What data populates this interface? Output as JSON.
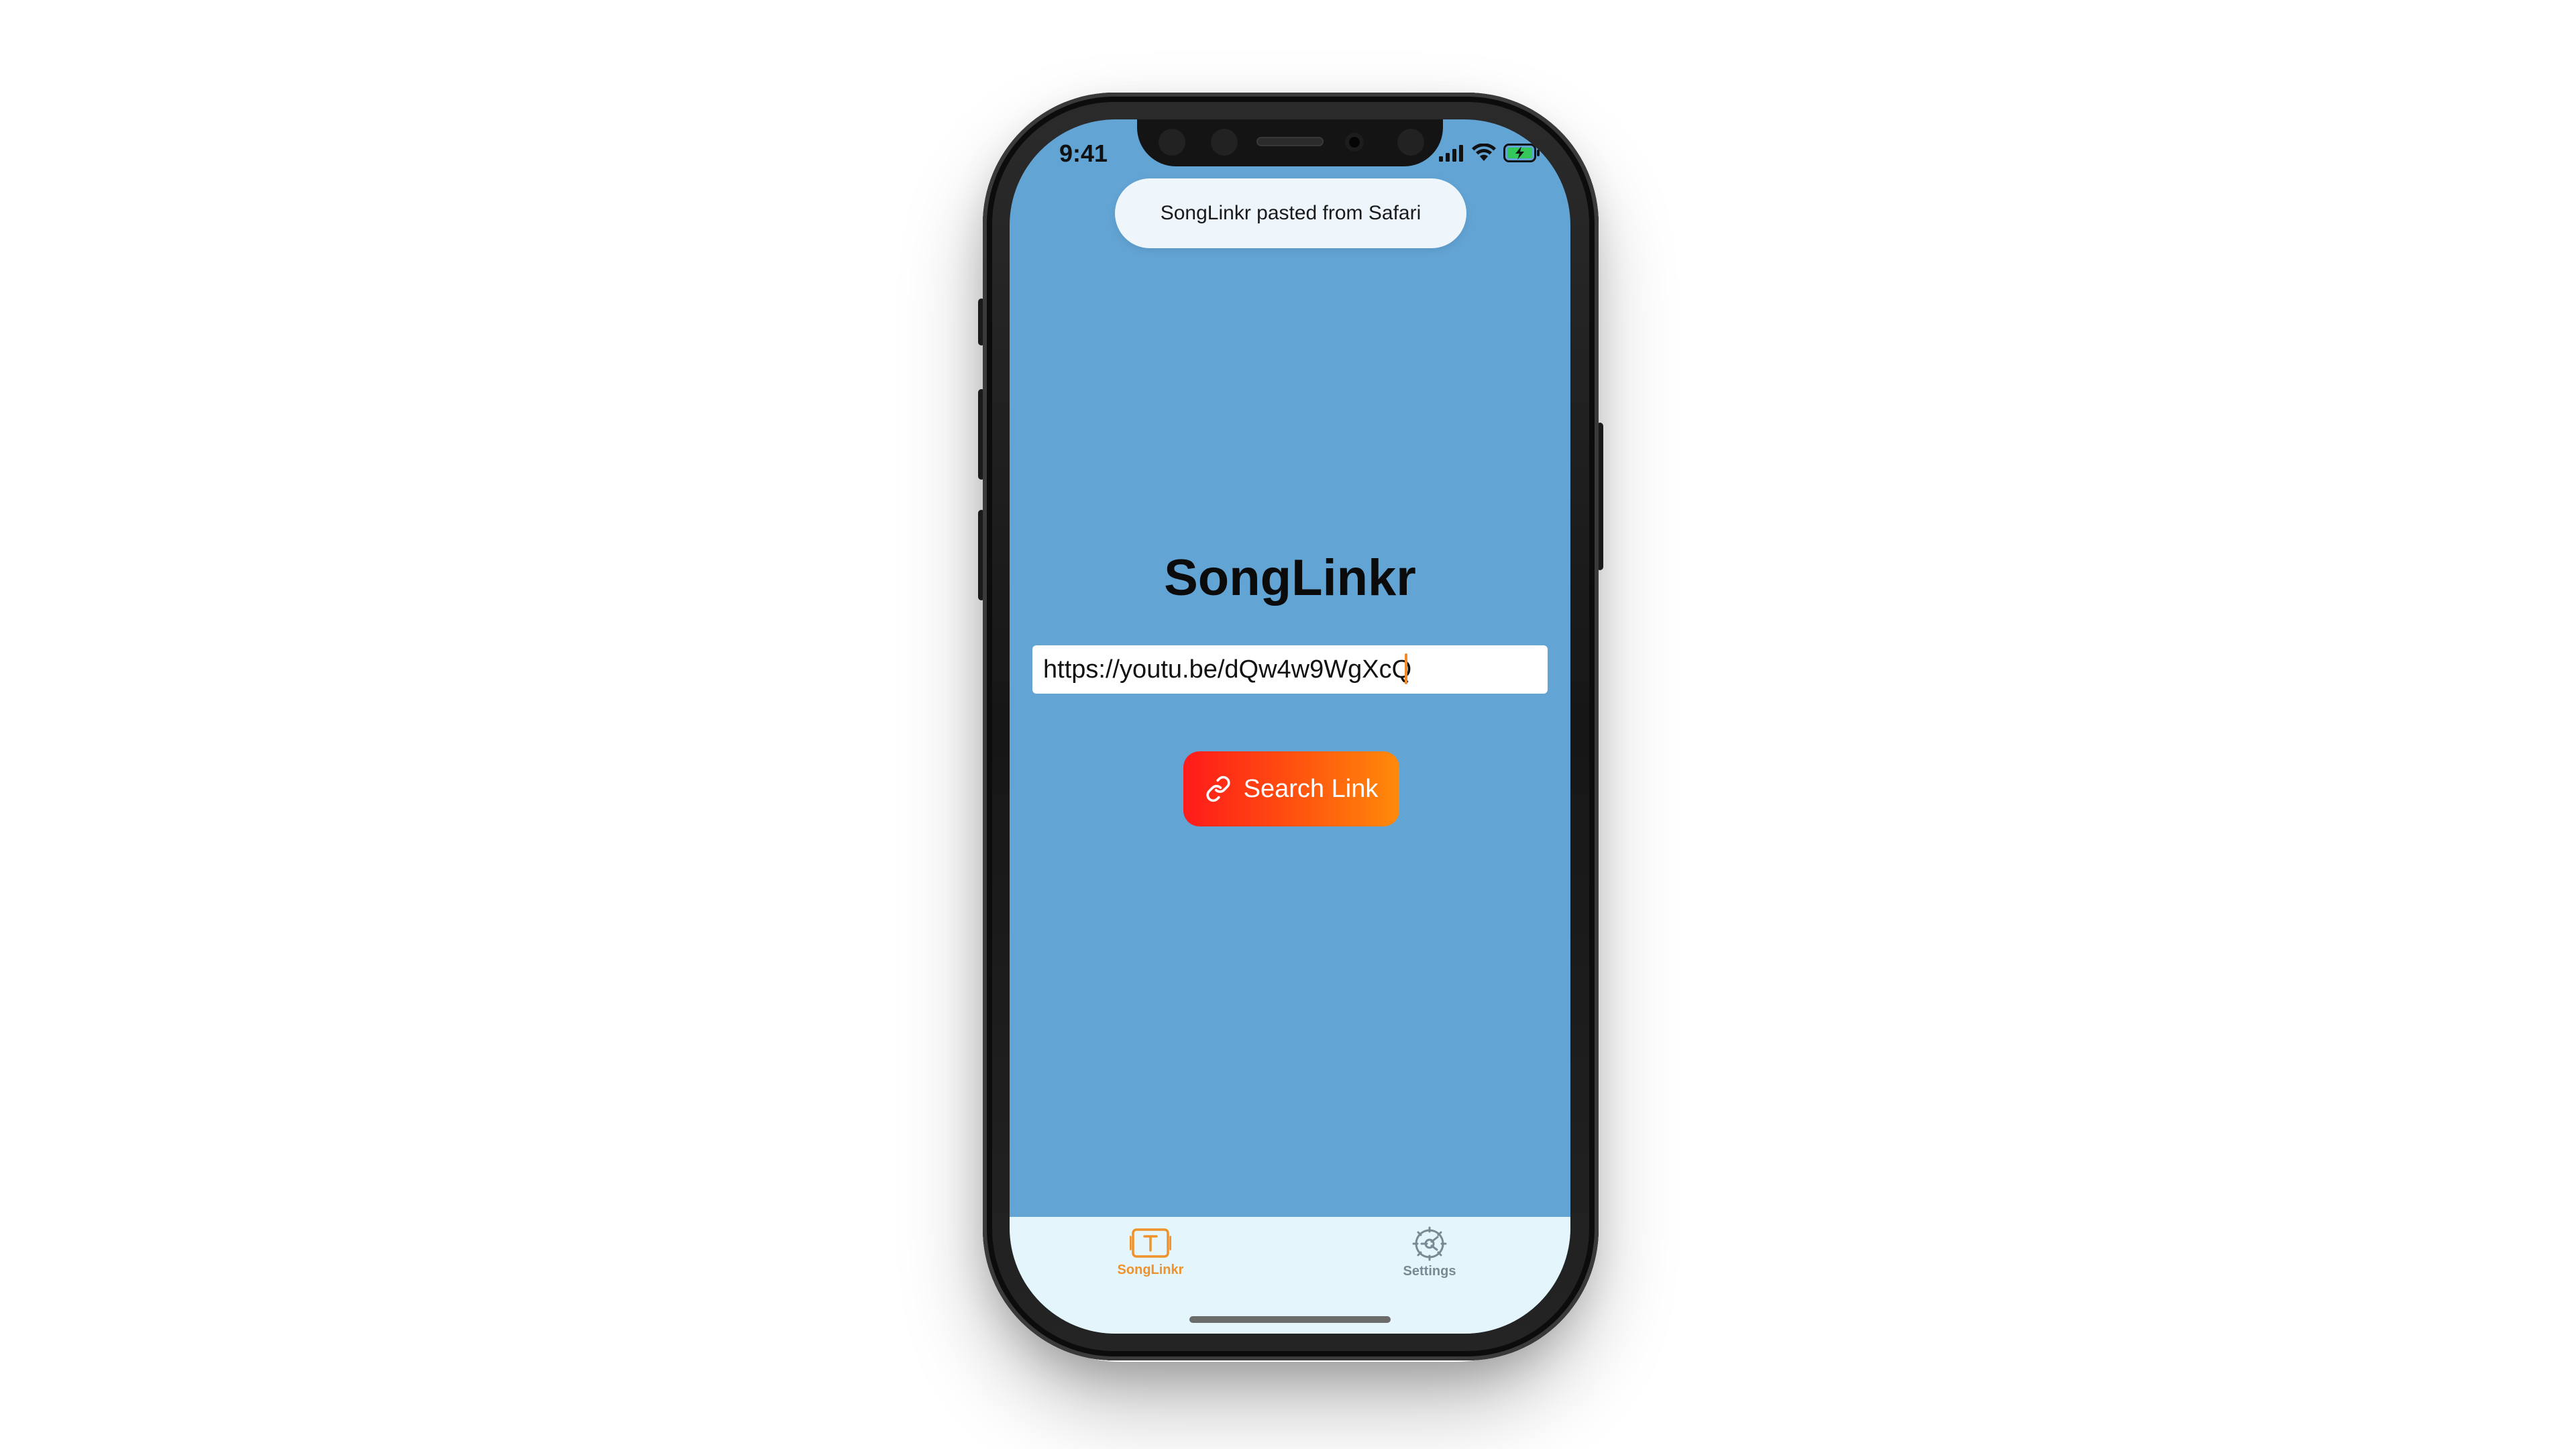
{
  "status_bar": {
    "time": "9:41"
  },
  "toast": {
    "text": "SongLinkr pasted from Safari"
  },
  "main": {
    "title": "SongLinkr",
    "url_input": {
      "value": "https://youtu.be/dQw4w9WgXcQ",
      "placeholder": ""
    },
    "search_button_label": "Search Link"
  },
  "tabbar": {
    "tabs": [
      {
        "label": "SongLinkr",
        "icon": "text-box-icon",
        "active": true
      },
      {
        "label": "Settings",
        "icon": "gear-icon",
        "active": false
      }
    ]
  },
  "colors": {
    "background": "#62a4d4",
    "accent": "#f0922a",
    "tab_inactive": "#7a8a94",
    "button_gradient_start": "#ff1a1a",
    "button_gradient_end": "#ff8a0a",
    "tabbar_background": "#e4f5fb",
    "toast_background": "#eef6fb"
  }
}
